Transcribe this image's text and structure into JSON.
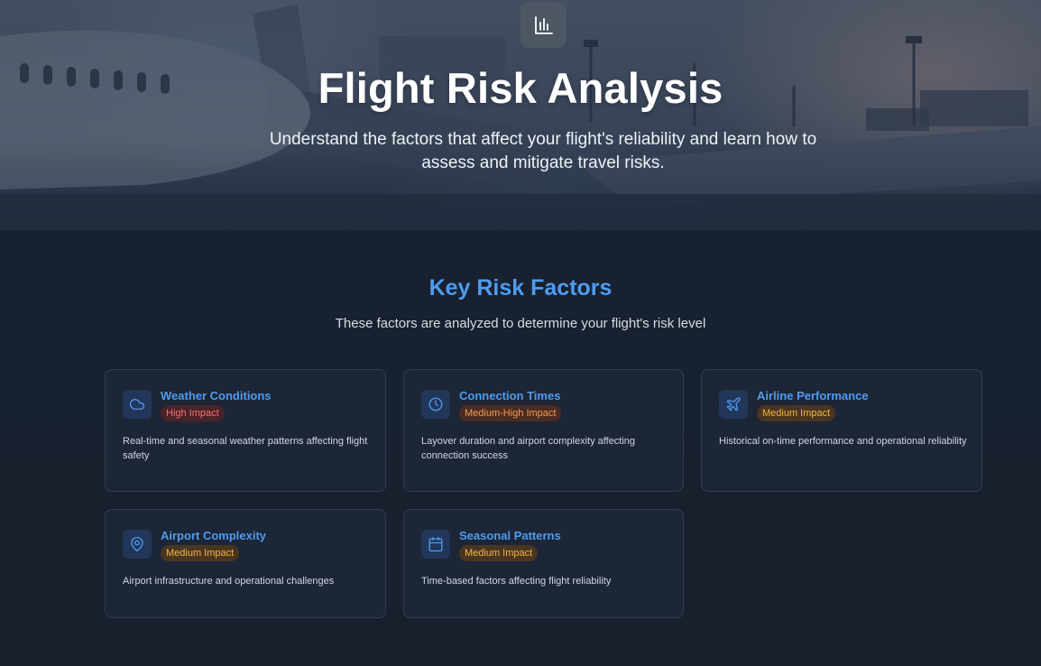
{
  "hero": {
    "title": "Flight Risk Analysis",
    "subtitle": "Understand the factors that affect your flight's reliability and learn how to assess and mitigate travel risks.",
    "icon": "bar-chart-icon"
  },
  "section": {
    "title": "Key Risk Factors",
    "subtitle": "These factors are analyzed to determine your flight's risk level"
  },
  "colors": {
    "accent": "#4f9bef",
    "high_impact": "#f3726f",
    "medium_high_impact": "#f59e4f",
    "medium_impact": "#f5b840",
    "background": "#172232"
  },
  "cards": [
    {
      "title": "Weather Conditions",
      "icon": "cloud-icon",
      "impact": "High Impact",
      "description": "Real-time and seasonal weather patterns affecting flight safety"
    },
    {
      "title": "Connection Times",
      "icon": "clock-icon",
      "impact": "Medium-High Impact",
      "description": "Layover duration and airport complexity affecting connection success"
    },
    {
      "title": "Airline Performance",
      "icon": "plane-icon",
      "impact": "Medium Impact",
      "description": "Historical on-time performance and operational reliability"
    },
    {
      "title": "Airport Complexity",
      "icon": "map-pin-icon",
      "impact": "Medium Impact",
      "description": "Airport infrastructure and operational challenges"
    },
    {
      "title": "Seasonal Patterns",
      "icon": "calendar-icon",
      "impact": "Medium Impact",
      "description": "Time-based factors affecting flight reliability"
    }
  ]
}
